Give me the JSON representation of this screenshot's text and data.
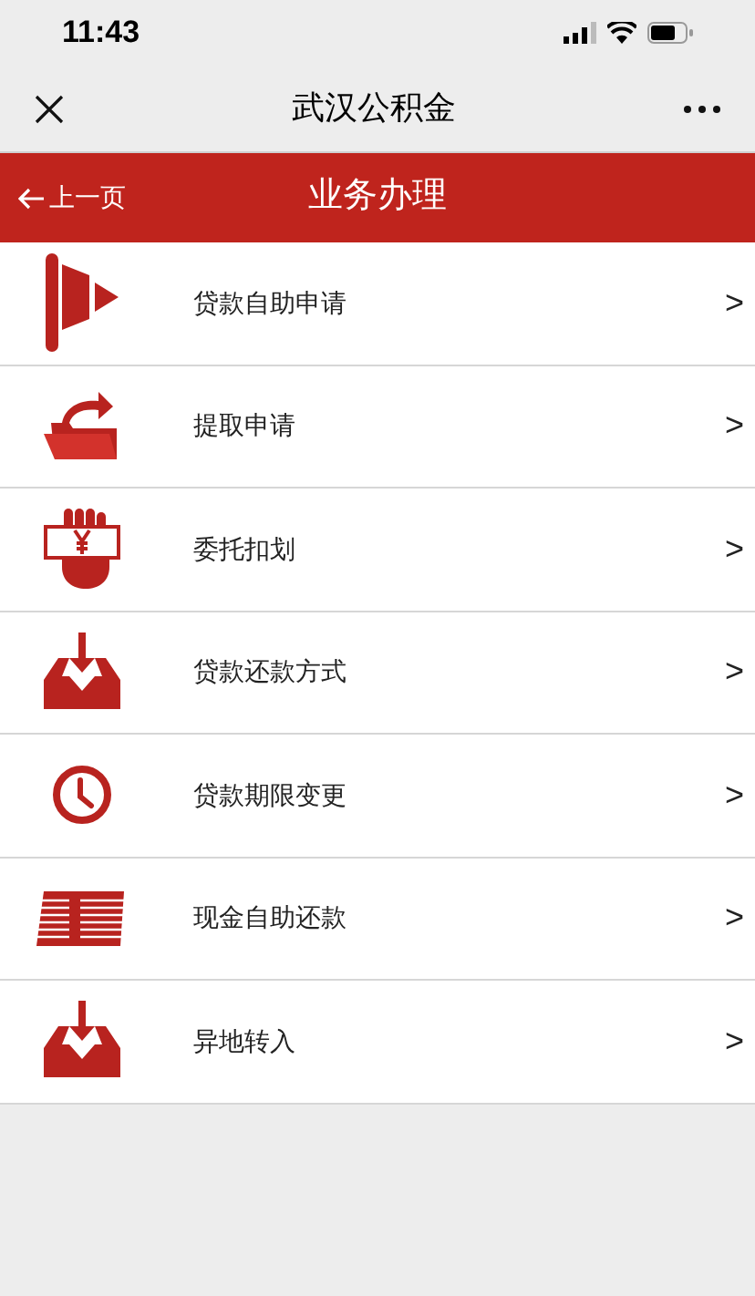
{
  "status_bar": {
    "time": "11:43"
  },
  "nav_bar": {
    "title": "武汉公积金"
  },
  "header": {
    "back": "上一页",
    "title": "业务办理"
  },
  "items": [
    {
      "kind": "flag",
      "label": "贷款自助申请",
      "arrow": ">"
    },
    {
      "kind": "folder",
      "label": "提取申请",
      "arrow": ">"
    },
    {
      "kind": "hand",
      "label": "委托扣划",
      "arrow": ">"
    },
    {
      "kind": "inbox",
      "label": "贷款还款方式",
      "arrow": ">"
    },
    {
      "kind": "clock",
      "label": "贷款期限变更",
      "arrow": ">"
    },
    {
      "kind": "money",
      "label": "现金自助还款",
      "arrow": ">"
    },
    {
      "kind": "inbox",
      "label": "异地转入",
      "arrow": ">"
    }
  ]
}
